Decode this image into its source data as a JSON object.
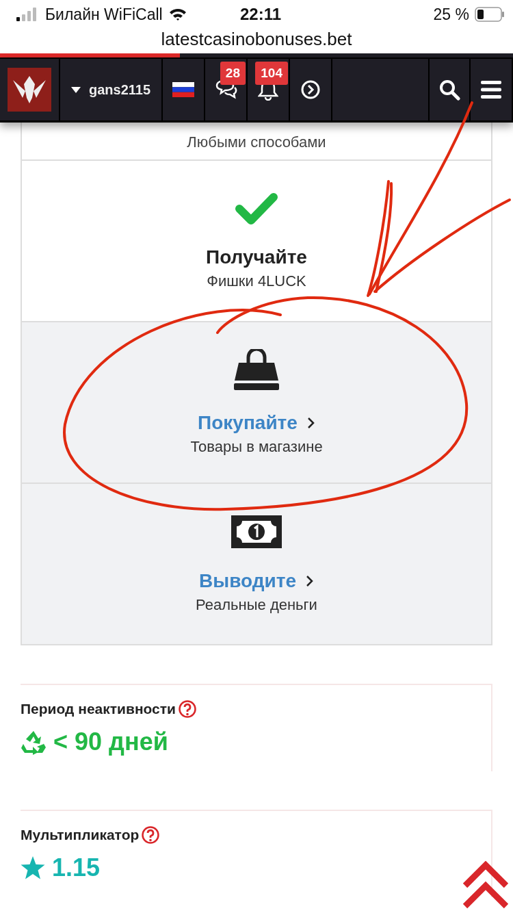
{
  "status_bar": {
    "carrier": "Билайн WiFiCall",
    "time": "22:11",
    "battery": "25 %"
  },
  "url": "latestcasinobonuses.bet",
  "loading_bar": {
    "level": 0.35
  },
  "header": {
    "username": "gans2115",
    "messages_badge": "28",
    "alerts_badge": "104"
  },
  "partial_row": "Любыми способами",
  "steps": [
    {
      "kind": "check",
      "title": "Получайте",
      "subtitle": "Фишки 4LUCK",
      "link": false
    },
    {
      "kind": "bag",
      "title": "Покупайте",
      "subtitle": "Товары в магазине",
      "link": true
    },
    {
      "kind": "money",
      "title": "Выводите",
      "subtitle": "Реальные деньги",
      "link": true
    }
  ],
  "stats": [
    {
      "kind": "recycle",
      "label": "Период неактивности",
      "value": "< 90 дней",
      "color": "#22b845"
    },
    {
      "kind": "star",
      "label": "Мультипликатор",
      "value": "1.15",
      "color": "#17b5b0"
    }
  ]
}
